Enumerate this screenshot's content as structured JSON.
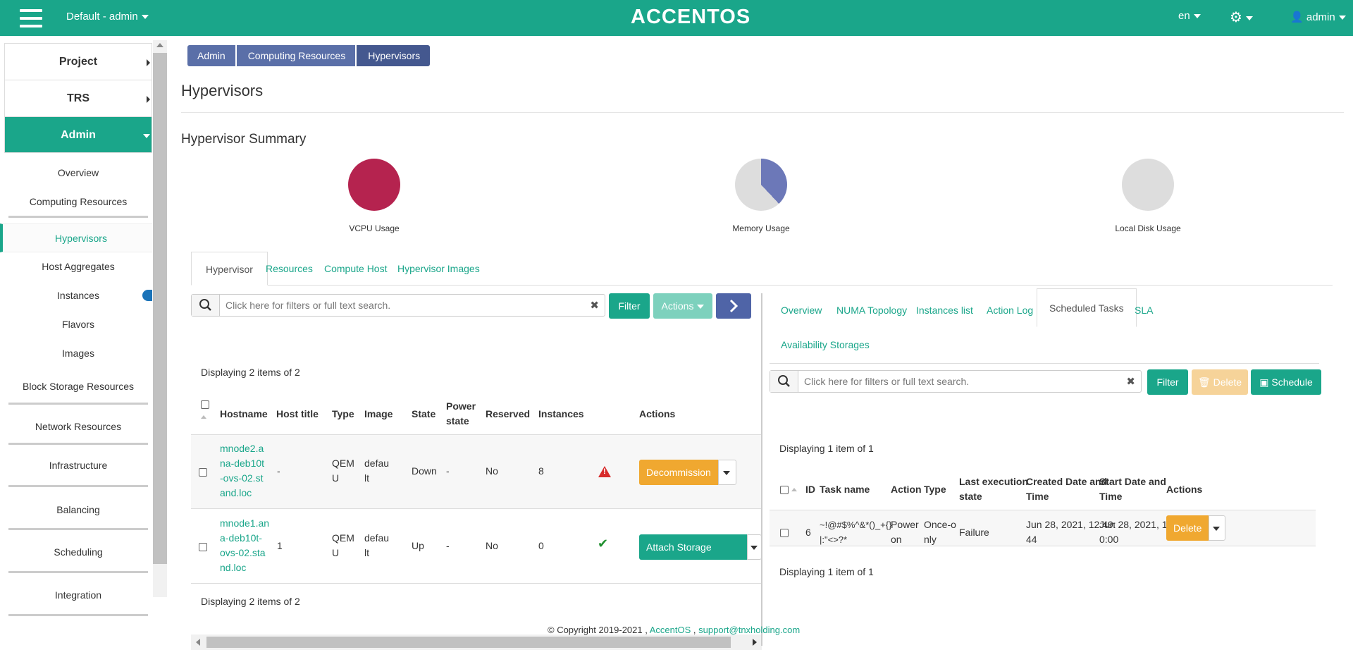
{
  "topbar": {
    "project": "Default - admin",
    "logo": "ACCENTOS",
    "language": "en",
    "user": "admin",
    "accent_color": "#1aa68a"
  },
  "sidebar": {
    "sections": [
      {
        "label": "Project"
      },
      {
        "label": "TRS"
      },
      {
        "label": "Admin"
      }
    ],
    "items": [
      {
        "label": "Overview"
      },
      {
        "label": "Computing Resources"
      },
      {
        "label": "Hypervisors"
      },
      {
        "label": "Host Aggregates"
      },
      {
        "label": "Instances"
      },
      {
        "label": "Flavors"
      },
      {
        "label": "Images"
      },
      {
        "label": "Block Storage Resources"
      },
      {
        "label": "Network Resources"
      },
      {
        "label": "Infrastructure"
      },
      {
        "label": "Balancing"
      },
      {
        "label": "Scheduling"
      },
      {
        "label": "Integration"
      }
    ]
  },
  "breadcrumb": [
    "Admin",
    "Computing Resources",
    "Hypervisors"
  ],
  "page_title": "Hypervisors",
  "summary": {
    "title": "Hypervisor Summary",
    "charts": [
      {
        "label": "VCPU Usage",
        "used_fraction": 1.0,
        "color": "#b5234f"
      },
      {
        "label": "Memory Usage",
        "used_fraction": 0.38,
        "color": "#6c78b8"
      },
      {
        "label": "Local Disk Usage",
        "used_fraction": 0.0,
        "color": "#dddddd"
      }
    ]
  },
  "tabs": [
    "Hypervisor",
    "Resources",
    "Compute Host",
    "Hypervisor Images"
  ],
  "left": {
    "search_placeholder": "Click here for filters or full text search.",
    "filter_label": "Filter",
    "actions_label": "Actions",
    "displaying": "Displaying 2 items of 2",
    "columns": [
      "Hostname",
      "Host title",
      "Type",
      "Image",
      "State",
      "Power state",
      "Reserved",
      "Instances",
      "Actions"
    ],
    "rows": [
      {
        "hostname": "mnode2.ana-deb10t-ovs-02.stand.loc",
        "hostname_lines": [
          "mnode2.a",
          "na-deb10t",
          "-ovs-02.st",
          "and.loc"
        ],
        "host_title": "-",
        "type_lines": [
          "QEM",
          "U"
        ],
        "image_lines": [
          "defau",
          "lt"
        ],
        "state": "Down",
        "power_state": "-",
        "reserved": "No",
        "instances": "8",
        "action": "Decommission"
      },
      {
        "hostname": "mnode1.ana-deb10t-ovs-02.stand.loc",
        "hostname_lines": [
          "mnode1.an",
          "a-deb10t-",
          "ovs-02.sta",
          "nd.loc"
        ],
        "host_title": "1",
        "type_lines": [
          "QEM",
          "U"
        ],
        "image_lines": [
          "defau",
          "lt"
        ],
        "state": "Up",
        "power_state": "-",
        "reserved": "No",
        "instances": "0",
        "action": "Attach Storage Volume"
      }
    ]
  },
  "right": {
    "tabs": [
      "Overview",
      "NUMA Topology",
      "Instances list",
      "Action Log",
      "Scheduled Tasks",
      "SLA",
      "Availability Storages"
    ],
    "search_placeholder": "Click here for filters or full text search.",
    "filter_label": "Filter",
    "delete_label": "Delete",
    "schedule_label": "Schedule",
    "displaying": "Displaying 1 item of 1",
    "columns": [
      "ID",
      "Task name",
      "Action",
      "Type",
      "Last execution state",
      "Created Date and Time",
      "Start Date and Time",
      "Actions"
    ],
    "column_lines": {
      "last_exec": [
        "Last execution",
        "state"
      ],
      "created": [
        "Created Date and",
        "Time"
      ],
      "start": [
        "Start Date and",
        "Time"
      ]
    },
    "rows": [
      {
        "id": "6",
        "task_lines": [
          "~!@#$%^&*()_+{}",
          "|:\"<>?*"
        ],
        "action_lines": [
          "Power",
          "on"
        ],
        "type_lines": [
          "Once-o",
          "nly"
        ],
        "state": "Failure",
        "created_lines": [
          "Jun 28, 2021, 12:49:",
          "44"
        ],
        "start_lines": [
          "Jun 28, 2021, 13:0",
          "0:00"
        ],
        "action": "Delete"
      }
    ]
  },
  "footer": {
    "copyright": "© Copyright 2019-2021 ,",
    "company": "AccentOS",
    "sep": ",",
    "email": "support@tnxholding.com"
  }
}
